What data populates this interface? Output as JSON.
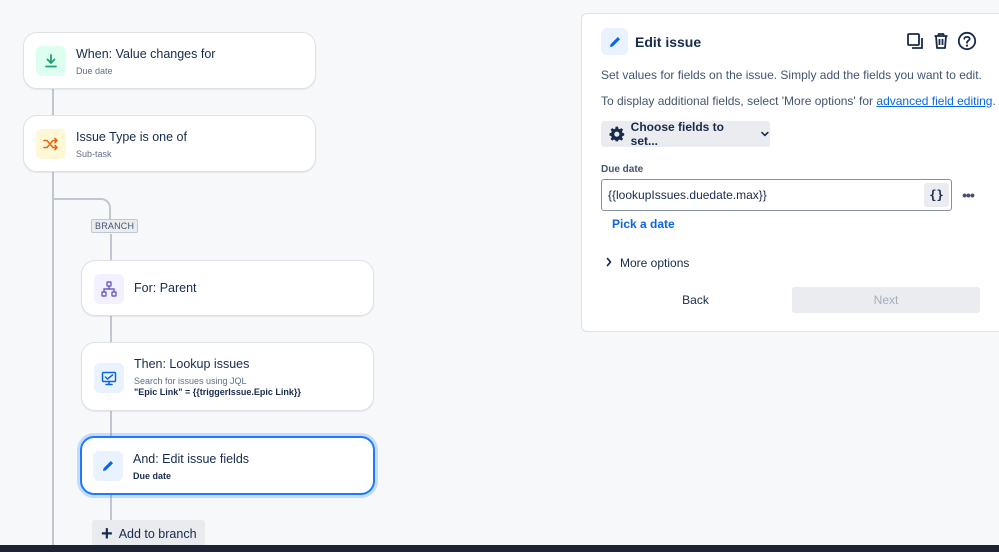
{
  "flow": {
    "trigger": {
      "title": "When: Value changes for",
      "subtitle": "Due date",
      "icon": "download-arrow-icon",
      "icon_color": "#22a06b",
      "icon_bg": "#dcfff1"
    },
    "condition": {
      "title": "Issue Type is one of",
      "subtitle": "Sub-task",
      "icon": "shuffle-icon",
      "icon_color": "#e56910",
      "icon_bg": "#fff7d6"
    },
    "branch_label": "BRANCH",
    "branch_node": {
      "title": "For: Parent",
      "icon": "hierarchy-icon",
      "icon_color": "#6e5dc6",
      "icon_bg": "#f3f0ff"
    },
    "lookup_node": {
      "title": "Then: Lookup issues",
      "subtitle": "Search for issues using JQL",
      "query": "\"Epic Link\" = {{triggerIssue.Epic Link}}",
      "icon": "monitor-icon",
      "icon_color": "#0c66e4",
      "icon_bg": "#e9f2ff"
    },
    "edit_node": {
      "title": "And: Edit issue fields",
      "subtitle": "Due date",
      "icon": "pencil-icon",
      "icon_color": "#0c66e4",
      "icon_bg": "#e9f2ff"
    },
    "add_branch_label": "Add to branch"
  },
  "panel": {
    "title": "Edit issue",
    "icon": "pencil-icon",
    "tools": [
      "duplicate-icon",
      "trash-icon",
      "help-icon"
    ],
    "description1": "Set values for fields on the issue. Simply add the fields you want to edit.",
    "description2_prefix": "To display additional fields, select 'More options' for ",
    "description2_link": "advanced field editing",
    "description2_suffix": ".",
    "choose_fields_label": "Choose fields to set...",
    "field_label": "Due date",
    "field_value": "{{lookupIssues.duedate.max}}",
    "smart_value_button": "{}",
    "more_dots": "•••",
    "pick_date_label": "Pick a date",
    "more_options_label": "More options",
    "back_label": "Back",
    "next_label": "Next",
    "accent": "#0c66e4"
  }
}
